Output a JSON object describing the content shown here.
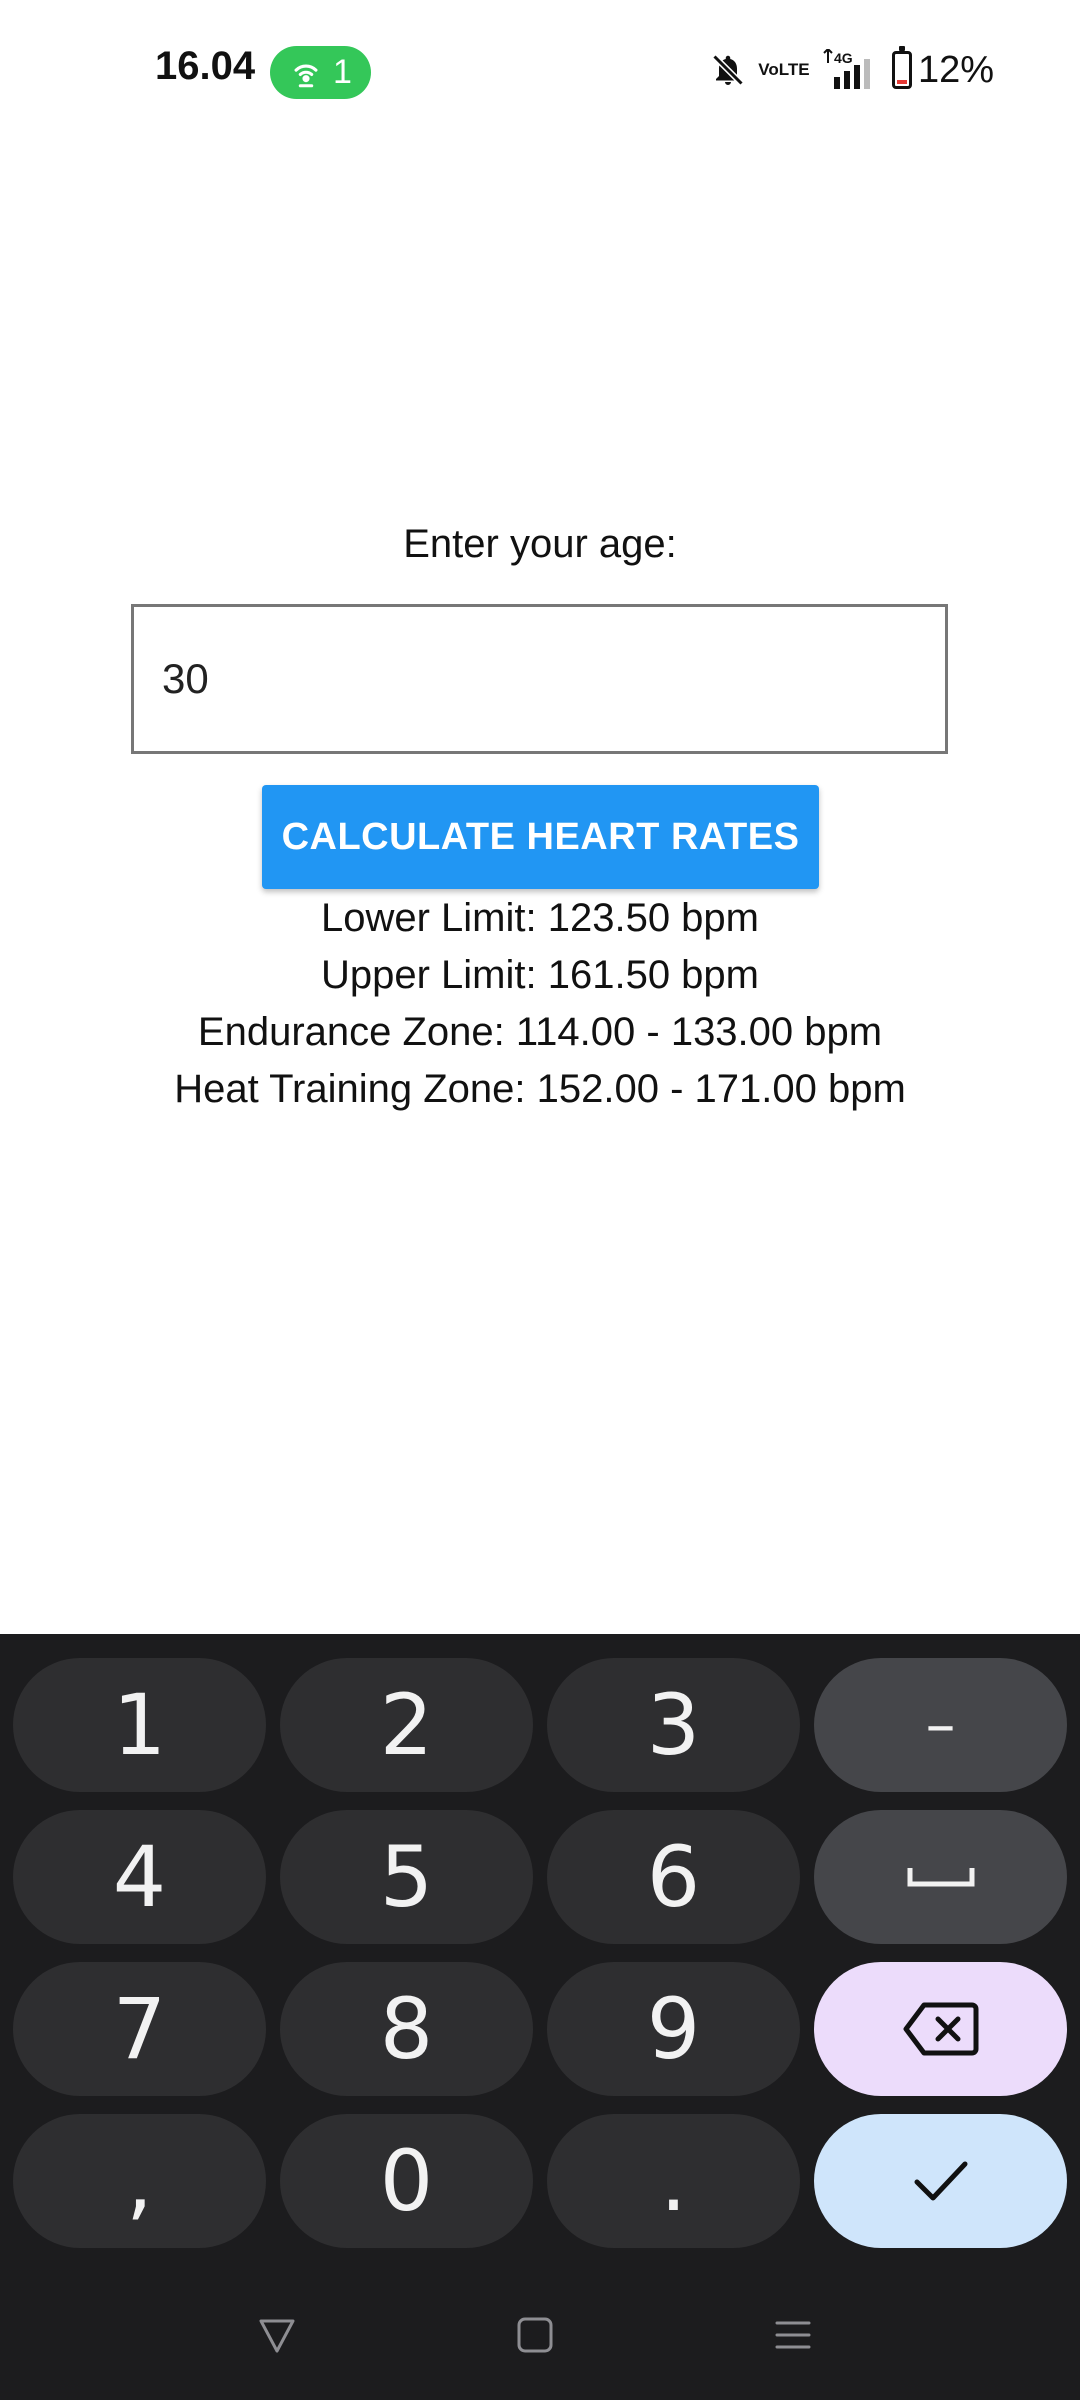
{
  "status_bar": {
    "time": "16.04",
    "hotspot_count": "1",
    "network_label_top": "Vo",
    "network_label_bottom": "LTE",
    "network_type": "4G",
    "battery_percent": "12%",
    "icons": [
      "hotspot-icon",
      "mute-bell-icon",
      "volte-icon",
      "signal-4g-icon",
      "battery-icon"
    ]
  },
  "form": {
    "prompt": "Enter your age:",
    "age_value": "30",
    "button_label": "CALCULATE HEART RATES"
  },
  "results": {
    "lower_limit": "Lower Limit: 123.50 bpm",
    "upper_limit": "Upper Limit: 161.50 bpm",
    "endurance_zone": "Endurance Zone: 114.00 - 133.00 bpm",
    "heat_training_zone": "Heat Training Zone: 152.00 - 171.00 bpm"
  },
  "keyboard": {
    "keys": {
      "k1": "1",
      "k2": "2",
      "k3": "3",
      "minus": "–",
      "k4": "4",
      "k5": "5",
      "k6": "6",
      "k7": "7",
      "k8": "8",
      "k9": "9",
      "comma": ",",
      "k0": "0",
      "period": "."
    },
    "colors": {
      "background": "#1c1c1e",
      "key": "#2e2e30",
      "function_key": "#45464a",
      "backspace_key": "#ecdcfb",
      "enter_key": "#cfe5fb"
    }
  },
  "theme": {
    "accent": "#2196f3",
    "hotspot_green": "#34c759",
    "battery_low": "#e53935"
  },
  "nav_bar": {
    "icons": [
      "back-icon",
      "home-icon",
      "recents-icon"
    ]
  }
}
